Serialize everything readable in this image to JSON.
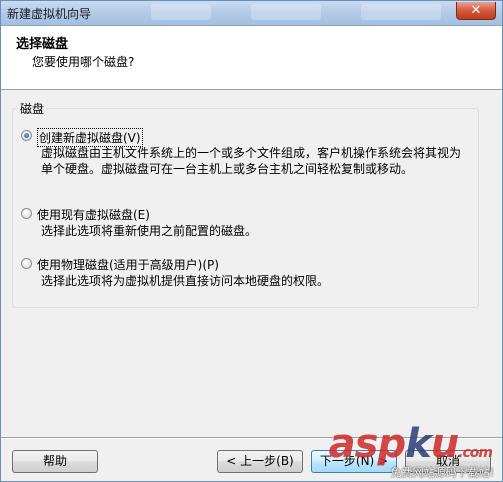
{
  "window": {
    "title": "新建虚拟机向导",
    "close_label": "✕"
  },
  "header": {
    "title": "选择磁盘",
    "subtitle": "您要使用哪个磁盘?"
  },
  "disk_group": {
    "legend": "磁盘",
    "options": [
      {
        "label": "创建新虚拟磁盘(V)",
        "description": "虚拟磁盘由主机文件系统上的一个或多个文件组成，客户机操作系统会将其视为单个硬盘。虚拟磁盘可在一台主机上或多台主机之间轻松复制或移动。",
        "checked": true
      },
      {
        "label": "使用现有虚拟磁盘(E)",
        "description": "选择此选项将重新使用之前配置的磁盘。",
        "checked": false
      },
      {
        "label": "使用物理磁盘(适用于高级用户)(P)",
        "description": "选择此选项将为虚拟机提供直接访问本地硬盘的权限。",
        "checked": false
      }
    ]
  },
  "footer": {
    "help_label": "帮助",
    "back_label": "< 上一步(B)",
    "next_label": "下一步(N) >",
    "cancel_label": "取消"
  },
  "watermark": {
    "brand_a": "asp",
    "brand_dot": "k",
    "brand_b": "u",
    "domain_suffix": ".com",
    "tagline": "免费网站源码下载站!"
  },
  "colors": {
    "titlebar": "#b4cbe6",
    "accent_radio": "#2a66c4",
    "close_button": "#c2391b",
    "default_button_border": "#3c7fb1"
  }
}
